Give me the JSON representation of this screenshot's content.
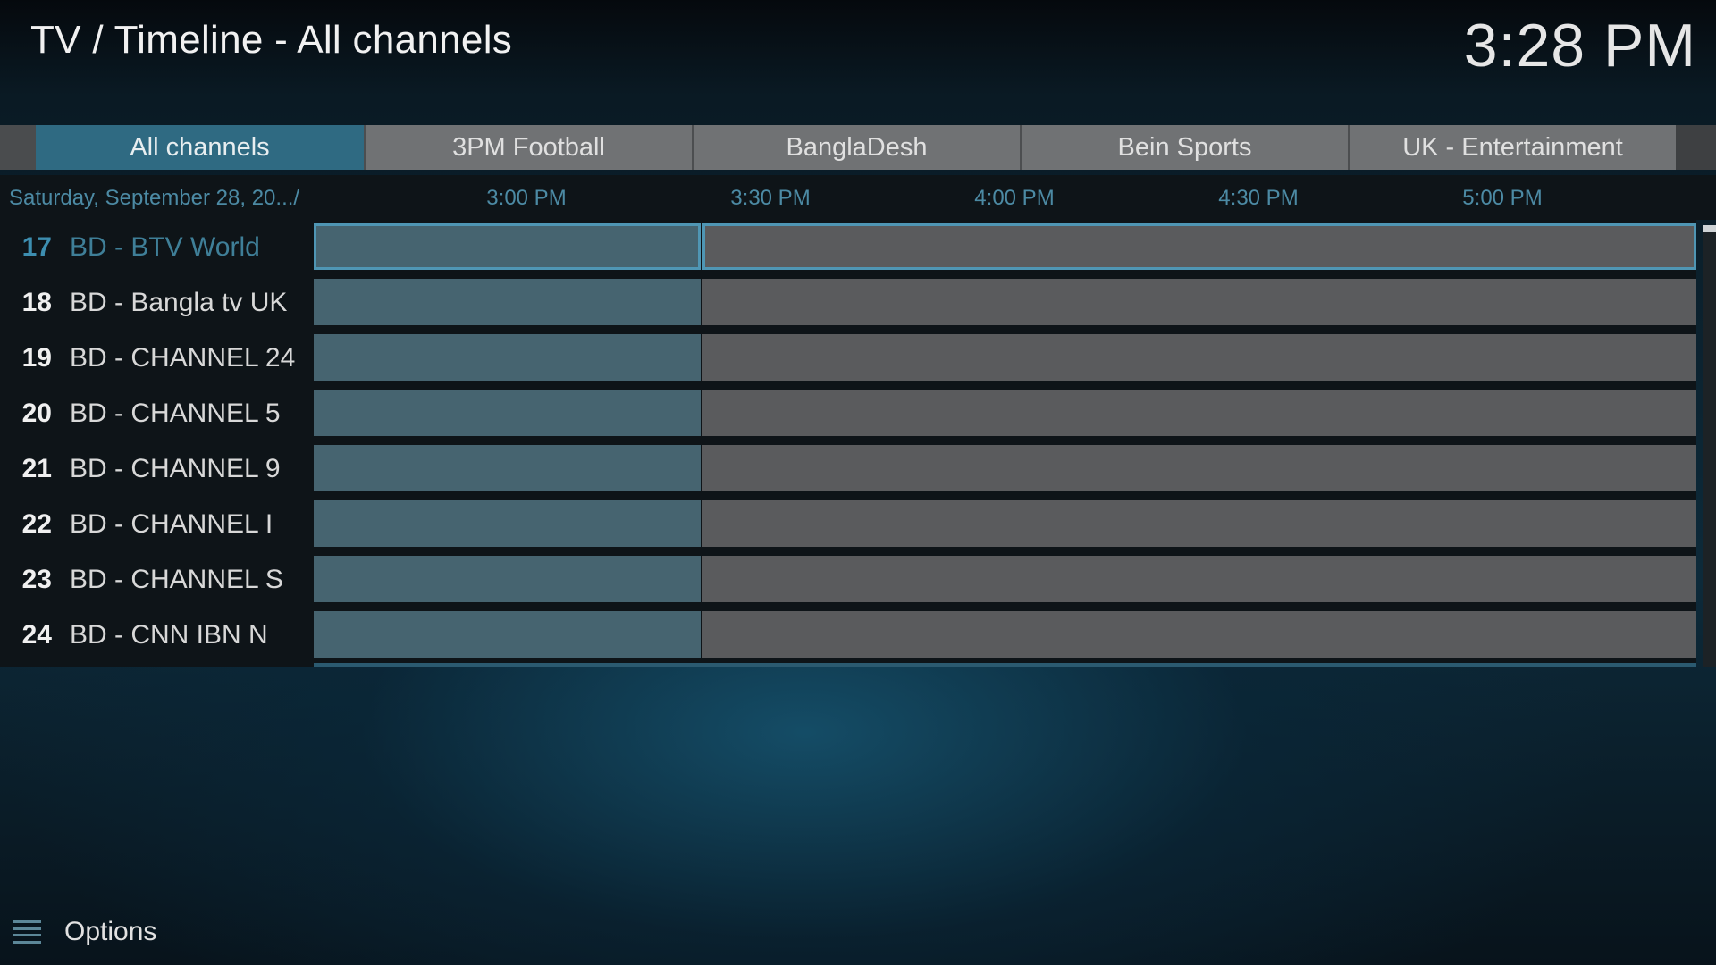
{
  "header": {
    "title": "TV / Timeline - All channels",
    "clock": "3:28 PM"
  },
  "tabs": [
    {
      "label": "All channels",
      "active": true
    },
    {
      "label": "3PM Football",
      "active": false
    },
    {
      "label": "BanglaDesh",
      "active": false
    },
    {
      "label": "Bein Sports",
      "active": false
    },
    {
      "label": "UK - Entertainment",
      "active": false
    }
  ],
  "timeline": {
    "date_label": "Saturday, September 28, 20.../",
    "ticks": [
      "3:00 PM",
      "3:30 PM",
      "4:00 PM",
      "4:30 PM",
      "5:00 PM"
    ]
  },
  "channels": [
    {
      "number": "17",
      "name": "BD - BTV World",
      "selected": true
    },
    {
      "number": "18",
      "name": "BD - Bangla tv UK",
      "selected": false
    },
    {
      "number": "19",
      "name": "BD - CHANNEL 24",
      "selected": false
    },
    {
      "number": "20",
      "name": "BD - CHANNEL 5",
      "selected": false
    },
    {
      "number": "21",
      "name": "BD - CHANNEL 9",
      "selected": false
    },
    {
      "number": "22",
      "name": "BD - CHANNEL I",
      "selected": false
    },
    {
      "number": "23",
      "name": "BD - CHANNEL S",
      "selected": false
    },
    {
      "number": "24",
      "name": "BD - CNN IBN N",
      "selected": false
    }
  ],
  "footer": {
    "options_label": "Options",
    "options_icon": "hamburger-menu-icon"
  },
  "colors": {
    "accent": "#2f6a82",
    "past_cell": "#466470",
    "future_cell": "#5a5b5d",
    "timeline_text": "#4c8aa4"
  }
}
